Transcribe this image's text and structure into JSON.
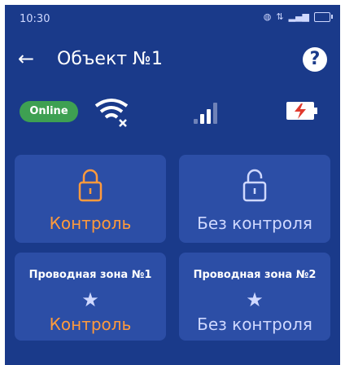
{
  "status_bar": {
    "time": "10:30",
    "icons": [
      "wifi-calling-icon",
      "network-speed-icon",
      "signal-icon",
      "battery-icon"
    ]
  },
  "header": {
    "back_label": "←",
    "title": "Объект №1",
    "help_label": "?"
  },
  "indicators": {
    "online_label": "Online",
    "wifi_state": "disconnected",
    "signal_level": 2,
    "signal_max": 4,
    "power_state": "charging"
  },
  "partitions": [
    {
      "status": "Контроль",
      "armed": true
    },
    {
      "status": "Без контроля",
      "armed": false
    }
  ],
  "zones": [
    {
      "label": "Проводная зона №1",
      "status": "Контроль",
      "armed": true
    },
    {
      "label": "Проводная зона №2",
      "status": "Без контроля",
      "armed": false
    }
  ],
  "colors": {
    "background": "#1a3a8a",
    "card": "#2c4ea6",
    "online_badge": "#3ea052",
    "armed_text": "#ff9a3c",
    "disarmed_text": "#cfd8ff"
  }
}
